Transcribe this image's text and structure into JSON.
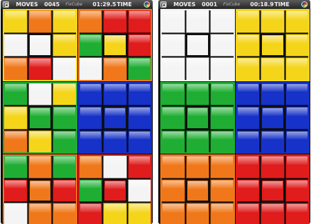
{
  "palette": {
    "Y": "#f4d51a",
    "O": "#f0781a",
    "R": "#e01c1c",
    "G": "#1fae33",
    "B": "#1632c8",
    "W": "#f4f4f4"
  },
  "icons": {
    "menu": "menu-icon",
    "color": "color-wheel-icon"
  },
  "screens": [
    {
      "moves_label": "MOVES",
      "moves_value": "0045",
      "game_name": "FixCube",
      "time_value": "01:29.5",
      "time_label": "TIME",
      "grid": [
        [
          "Y",
          "O",
          "Y",
          "O",
          "R",
          "R"
        ],
        [
          "W",
          "W",
          "Y",
          "G",
          "Y",
          "R"
        ],
        [
          "O",
          "R",
          "W",
          "W",
          "O",
          "G"
        ],
        [
          "G",
          "W",
          "Y",
          "B",
          "B",
          "B"
        ],
        [
          "Y",
          "G",
          "G",
          "B",
          "B",
          "B"
        ],
        [
          "O",
          "Y",
          "G",
          "B",
          "B",
          "B"
        ],
        [
          "G",
          "O",
          "G",
          "O",
          "W",
          "R"
        ],
        [
          "R",
          "O",
          "R",
          "G",
          "R",
          "W"
        ],
        [
          "W",
          "O",
          "O",
          "R",
          "Y",
          "Y"
        ]
      ],
      "selected": [
        [
          1,
          1
        ],
        [
          1,
          4
        ],
        [
          4,
          1
        ],
        [
          4,
          4
        ],
        [
          7,
          1
        ],
        [
          7,
          4
        ]
      ],
      "quadrant_borders": [
        "Y",
        "O",
        "G",
        "B",
        "O",
        "R"
      ]
    },
    {
      "moves_label": "MOVES",
      "moves_value": "0001",
      "game_name": "FixCube",
      "time_value": "00:18.9",
      "time_label": "TIME",
      "grid": [
        [
          "W",
          "W",
          "W",
          "Y",
          "Y",
          "Y"
        ],
        [
          "W",
          "W",
          "W",
          "Y",
          "Y",
          "Y"
        ],
        [
          "W",
          "W",
          "W",
          "Y",
          "Y",
          "Y"
        ],
        [
          "G",
          "G",
          "G",
          "B",
          "B",
          "B"
        ],
        [
          "G",
          "G",
          "G",
          "B",
          "B",
          "B"
        ],
        [
          "G",
          "G",
          "G",
          "B",
          "B",
          "B"
        ],
        [
          "O",
          "O",
          "O",
          "R",
          "R",
          "R"
        ],
        [
          "O",
          "O",
          "O",
          "R",
          "R",
          "R"
        ],
        [
          "O",
          "O",
          "O",
          "R",
          "R",
          "R"
        ]
      ],
      "selected": [
        [
          1,
          1
        ],
        [
          1,
          4
        ],
        [
          4,
          1
        ],
        [
          4,
          4
        ],
        [
          7,
          1
        ],
        [
          7,
          4
        ]
      ],
      "quadrant_borders": [
        "W",
        "Y",
        "G",
        "B",
        "O",
        "R"
      ]
    }
  ]
}
